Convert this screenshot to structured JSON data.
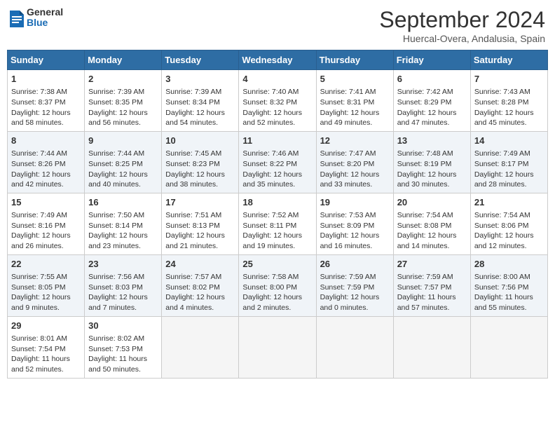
{
  "header": {
    "logo": {
      "general": "General",
      "blue": "Blue"
    },
    "title": "September 2024",
    "location": "Huercal-Overa, Andalusia, Spain"
  },
  "days_of_week": [
    "Sunday",
    "Monday",
    "Tuesday",
    "Wednesday",
    "Thursday",
    "Friday",
    "Saturday"
  ],
  "weeks": [
    {
      "days": [
        {
          "num": "1",
          "lines": [
            "Sunrise: 7:38 AM",
            "Sunset: 8:37 PM",
            "Daylight: 12 hours",
            "and 58 minutes."
          ]
        },
        {
          "num": "2",
          "lines": [
            "Sunrise: 7:39 AM",
            "Sunset: 8:35 PM",
            "Daylight: 12 hours",
            "and 56 minutes."
          ]
        },
        {
          "num": "3",
          "lines": [
            "Sunrise: 7:39 AM",
            "Sunset: 8:34 PM",
            "Daylight: 12 hours",
            "and 54 minutes."
          ]
        },
        {
          "num": "4",
          "lines": [
            "Sunrise: 7:40 AM",
            "Sunset: 8:32 PM",
            "Daylight: 12 hours",
            "and 52 minutes."
          ]
        },
        {
          "num": "5",
          "lines": [
            "Sunrise: 7:41 AM",
            "Sunset: 8:31 PM",
            "Daylight: 12 hours",
            "and 49 minutes."
          ]
        },
        {
          "num": "6",
          "lines": [
            "Sunrise: 7:42 AM",
            "Sunset: 8:29 PM",
            "Daylight: 12 hours",
            "and 47 minutes."
          ]
        },
        {
          "num": "7",
          "lines": [
            "Sunrise: 7:43 AM",
            "Sunset: 8:28 PM",
            "Daylight: 12 hours",
            "and 45 minutes."
          ]
        }
      ]
    },
    {
      "days": [
        {
          "num": "8",
          "lines": [
            "Sunrise: 7:44 AM",
            "Sunset: 8:26 PM",
            "Daylight: 12 hours",
            "and 42 minutes."
          ]
        },
        {
          "num": "9",
          "lines": [
            "Sunrise: 7:44 AM",
            "Sunset: 8:25 PM",
            "Daylight: 12 hours",
            "and 40 minutes."
          ]
        },
        {
          "num": "10",
          "lines": [
            "Sunrise: 7:45 AM",
            "Sunset: 8:23 PM",
            "Daylight: 12 hours",
            "and 38 minutes."
          ]
        },
        {
          "num": "11",
          "lines": [
            "Sunrise: 7:46 AM",
            "Sunset: 8:22 PM",
            "Daylight: 12 hours",
            "and 35 minutes."
          ]
        },
        {
          "num": "12",
          "lines": [
            "Sunrise: 7:47 AM",
            "Sunset: 8:20 PM",
            "Daylight: 12 hours",
            "and 33 minutes."
          ]
        },
        {
          "num": "13",
          "lines": [
            "Sunrise: 7:48 AM",
            "Sunset: 8:19 PM",
            "Daylight: 12 hours",
            "and 30 minutes."
          ]
        },
        {
          "num": "14",
          "lines": [
            "Sunrise: 7:49 AM",
            "Sunset: 8:17 PM",
            "Daylight: 12 hours",
            "and 28 minutes."
          ]
        }
      ]
    },
    {
      "days": [
        {
          "num": "15",
          "lines": [
            "Sunrise: 7:49 AM",
            "Sunset: 8:16 PM",
            "Daylight: 12 hours",
            "and 26 minutes."
          ]
        },
        {
          "num": "16",
          "lines": [
            "Sunrise: 7:50 AM",
            "Sunset: 8:14 PM",
            "Daylight: 12 hours",
            "and 23 minutes."
          ]
        },
        {
          "num": "17",
          "lines": [
            "Sunrise: 7:51 AM",
            "Sunset: 8:13 PM",
            "Daylight: 12 hours",
            "and 21 minutes."
          ]
        },
        {
          "num": "18",
          "lines": [
            "Sunrise: 7:52 AM",
            "Sunset: 8:11 PM",
            "Daylight: 12 hours",
            "and 19 minutes."
          ]
        },
        {
          "num": "19",
          "lines": [
            "Sunrise: 7:53 AM",
            "Sunset: 8:09 PM",
            "Daylight: 12 hours",
            "and 16 minutes."
          ]
        },
        {
          "num": "20",
          "lines": [
            "Sunrise: 7:54 AM",
            "Sunset: 8:08 PM",
            "Daylight: 12 hours",
            "and 14 minutes."
          ]
        },
        {
          "num": "21",
          "lines": [
            "Sunrise: 7:54 AM",
            "Sunset: 8:06 PM",
            "Daylight: 12 hours",
            "and 12 minutes."
          ]
        }
      ]
    },
    {
      "days": [
        {
          "num": "22",
          "lines": [
            "Sunrise: 7:55 AM",
            "Sunset: 8:05 PM",
            "Daylight: 12 hours",
            "and 9 minutes."
          ]
        },
        {
          "num": "23",
          "lines": [
            "Sunrise: 7:56 AM",
            "Sunset: 8:03 PM",
            "Daylight: 12 hours",
            "and 7 minutes."
          ]
        },
        {
          "num": "24",
          "lines": [
            "Sunrise: 7:57 AM",
            "Sunset: 8:02 PM",
            "Daylight: 12 hours",
            "and 4 minutes."
          ]
        },
        {
          "num": "25",
          "lines": [
            "Sunrise: 7:58 AM",
            "Sunset: 8:00 PM",
            "Daylight: 12 hours",
            "and 2 minutes."
          ]
        },
        {
          "num": "26",
          "lines": [
            "Sunrise: 7:59 AM",
            "Sunset: 7:59 PM",
            "Daylight: 12 hours",
            "and 0 minutes."
          ]
        },
        {
          "num": "27",
          "lines": [
            "Sunrise: 7:59 AM",
            "Sunset: 7:57 PM",
            "Daylight: 11 hours",
            "and 57 minutes."
          ]
        },
        {
          "num": "28",
          "lines": [
            "Sunrise: 8:00 AM",
            "Sunset: 7:56 PM",
            "Daylight: 11 hours",
            "and 55 minutes."
          ]
        }
      ]
    },
    {
      "days": [
        {
          "num": "29",
          "lines": [
            "Sunrise: 8:01 AM",
            "Sunset: 7:54 PM",
            "Daylight: 11 hours",
            "and 52 minutes."
          ]
        },
        {
          "num": "30",
          "lines": [
            "Sunrise: 8:02 AM",
            "Sunset: 7:53 PM",
            "Daylight: 11 hours",
            "and 50 minutes."
          ]
        },
        null,
        null,
        null,
        null,
        null
      ]
    }
  ]
}
